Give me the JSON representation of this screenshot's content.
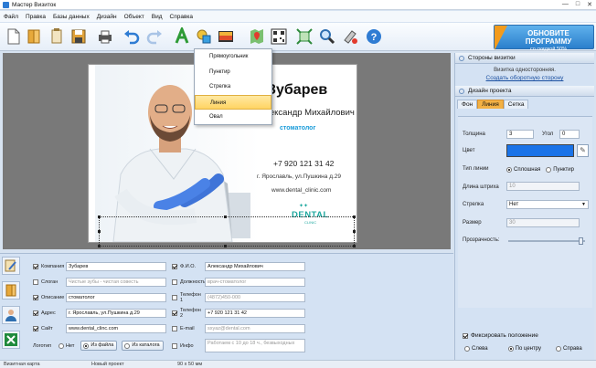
{
  "window": {
    "title": "Мастер Визиток",
    "minimize": "—",
    "maximize": "□",
    "close": "✕"
  },
  "menu": [
    "Файл",
    "Правка",
    "Базы данных",
    "Дизайн",
    "Объект",
    "Вид",
    "Справка"
  ],
  "toolbar": {
    "icons": [
      "new-file-icon",
      "open-folder-icon",
      "open-template-icon",
      "save-icon",
      "print-icon",
      "undo-icon",
      "redo-icon",
      "text-icon",
      "shapes-icon",
      "image-icon",
      "map-icon",
      "qr-code-icon",
      "fit-icon",
      "zoom-icon",
      "paint-icon",
      "help-icon"
    ],
    "upgrade_title": "ОБНОВИТЕ ПРОГРАММУ",
    "upgrade_sub": "со скидкой 50%"
  },
  "shape_menu": {
    "items": [
      "Прямоугольник",
      "Пунктир",
      "Стрелка",
      "Линия",
      "Овал"
    ],
    "highlighted": "Линия"
  },
  "card": {
    "surname": "Зубарев",
    "name": "Александр Михайлович",
    "position": "стоматолог",
    "phone": "+7 920 121 31 42",
    "address": "г. Ярославль, ул.Пушкина д.29",
    "site": "www.dental_clinic.com",
    "logo_main": "DENTAL",
    "logo_sub": "CLINIC",
    "accent_color": "#1a9bd9"
  },
  "fields": {
    "company": {
      "label": "Компания",
      "value": "Зубарев",
      "checked": true
    },
    "slogan": {
      "label": "Слоган",
      "value": "Чистые зубы - чистая совесть",
      "checked": false
    },
    "description": {
      "label": "Описание",
      "value": "стоматолог",
      "checked": true
    },
    "address": {
      "label": "Адрес",
      "value": "г. Ярославль, ул.Пушкина д.29",
      "checked": true
    },
    "site": {
      "label": "Сайт",
      "value": "www.dental_clinc.com",
      "checked": true
    },
    "logo": {
      "label": "Логотип",
      "opt_none": "Нет",
      "opt_file": "Из файла",
      "opt_catalog": "Из каталога"
    },
    "fio": {
      "label": "Ф.И.О.",
      "value": "Александр Михайлович",
      "checked": true
    },
    "position": {
      "label": "Должность",
      "value": "врач-стоматолог",
      "checked": false
    },
    "phone1": {
      "label": "Телефон 1",
      "value": "(4872)450-000",
      "checked": false
    },
    "phone2": {
      "label": "Телефон 2",
      "value": "+7 920 121 31 42",
      "checked": true
    },
    "email": {
      "label": "E-mail",
      "value": "sxyaz@dental.com",
      "checked": false
    },
    "info": {
      "label": "Инфо",
      "value": "Работаем с 10 до 18 ч., безвыходных",
      "checked": false
    }
  },
  "right_panel": {
    "sides_header": "Стороны визитки",
    "sides_text": "Визитка односторонняя.",
    "sides_link": "Создать оборотную сторону",
    "design_header": "Дизайн проекта",
    "tabs": [
      "Фон",
      "Линия",
      "Сетка"
    ],
    "active_tab": "Линия",
    "thickness_label": "Толщина",
    "thickness": "3",
    "angle_label": "Угол",
    "angle": "0",
    "color_label": "Цвет",
    "line_color": "#1a73e8",
    "line_type_label": "Тип линии",
    "line_solid": "Сплошная",
    "line_dash": "Пунктир",
    "dash_length_label": "Длина штриха",
    "dash_length": "10",
    "arrow_label": "Стрелка",
    "arrow_value": "Нет",
    "size_label": "Размер",
    "size_value": "30",
    "transparency_label": "Прозрачность:",
    "transparency_pct": 100,
    "fix_label": "Фиксировать положение",
    "pos_left": "Слева",
    "pos_center": "По центру",
    "pos_right": "Справа"
  },
  "status": {
    "type": "Визитная карта",
    "project": "Новый проект",
    "size": "90 x 50 мм"
  }
}
